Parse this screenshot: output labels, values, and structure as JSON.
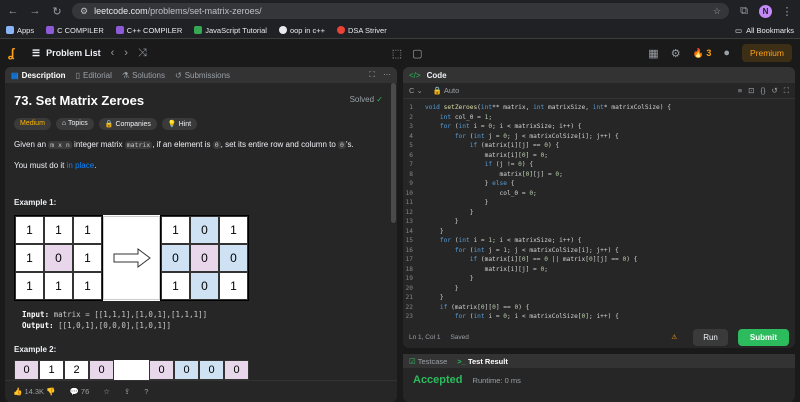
{
  "browser": {
    "url_host": "leetcode.com",
    "url_path": "/problems/set-matrix-zeroes/",
    "profile_initial": "N"
  },
  "bookmarks": {
    "items": [
      {
        "label": "Apps",
        "color": "#8ab4f8"
      },
      {
        "label": "C COMPILER",
        "color": "#8e5bd8"
      },
      {
        "label": "C++ COMPILER",
        "color": "#8e5bd8"
      },
      {
        "label": "JavaScript Tutorial",
        "color": "#34a853"
      },
      {
        "label": "oop in c++",
        "color": "#e8eaed"
      },
      {
        "label": "DSA Striver",
        "color": "#ea4335"
      }
    ],
    "all_label": "All Bookmarks"
  },
  "header": {
    "problem_list": "Problem List",
    "streak": "3",
    "premium": "Premium"
  },
  "tabs": {
    "description": "Description",
    "editorial": "Editorial",
    "solutions": "Solutions",
    "submissions": "Submissions"
  },
  "problem": {
    "title": "73. Set Matrix Zeroes",
    "solved": "Solved",
    "tags": [
      "Medium",
      "Topics",
      "Companies",
      "Hint"
    ],
    "stmt_a": "Given an ",
    "stmt_code1": "m x n",
    "stmt_b": " integer matrix ",
    "stmt_code2": "matrix",
    "stmt_c": ", if an element is ",
    "stmt_code3": "0",
    "stmt_d": ", set its entire row and column to ",
    "stmt_code4": "0",
    "stmt_e": "'s.",
    "must_a": "You must do it ",
    "must_link": "in place",
    "must_b": ".",
    "ex1_title": "Example 1:",
    "ex1_input_label": "Input:",
    "ex1_input": " matrix = [[1,1,1],[1,0,1],[1,1,1]]",
    "ex1_output_label": "Output:",
    "ex1_output": " [[1,0,1],[0,0,0],[1,0,1]]",
    "ex2_title": "Example 2:",
    "ex1_before": [
      "1",
      "1",
      "1",
      "1",
      "0",
      "1",
      "1",
      "1",
      "1"
    ],
    "ex1_after": [
      "1",
      "0",
      "1",
      "0",
      "0",
      "0",
      "1",
      "0",
      "1"
    ],
    "ex2_before": [
      "0",
      "1",
      "2",
      "0"
    ],
    "ex2_after": [
      "0",
      "0",
      "0",
      "0"
    ]
  },
  "bottom": {
    "likes": "14.3K",
    "comments": "76"
  },
  "editor": {
    "title": "Code",
    "lang": "C",
    "auto": "Auto",
    "status_pos": "Ln 1, Col 1",
    "status_saved": "Saved",
    "run": "Run",
    "submit": "Submit"
  },
  "code_lines": [
    "void setZeroes(int** matrix, int matrixSize, int* matrixColSize) {",
    "    int col_0 = 1;",
    "    for (int i = 0; i < matrixSize; i++) {",
    "        for (int j = 0; j < matrixColSize[i]; j++) {",
    "            if (matrix[i][j] == 0) {",
    "                matrix[i][0] = 0;",
    "                if (j != 0) {",
    "                    matrix[0][j] = 0;",
    "                } else {",
    "                    col_0 = 0;",
    "                }",
    "            }",
    "        }",
    "    }",
    "    for (int i = 1; i < matrixSize; i++) {",
    "        for (int j = 1; j < matrixColSize[i]; j++) {",
    "            if (matrix[i][0] == 0 || matrix[0][j] == 0) {",
    "                matrix[i][j] = 0;",
    "            }",
    "        }",
    "    }",
    "    if (matrix[0][0] == 0) {",
    "        for (int i = 0; i < matrixColSize[0]; i++) {"
  ],
  "result": {
    "testcase": "Testcase",
    "test_result": "Test Result",
    "status": "Accepted",
    "runtime": "Runtime: 0 ms"
  }
}
